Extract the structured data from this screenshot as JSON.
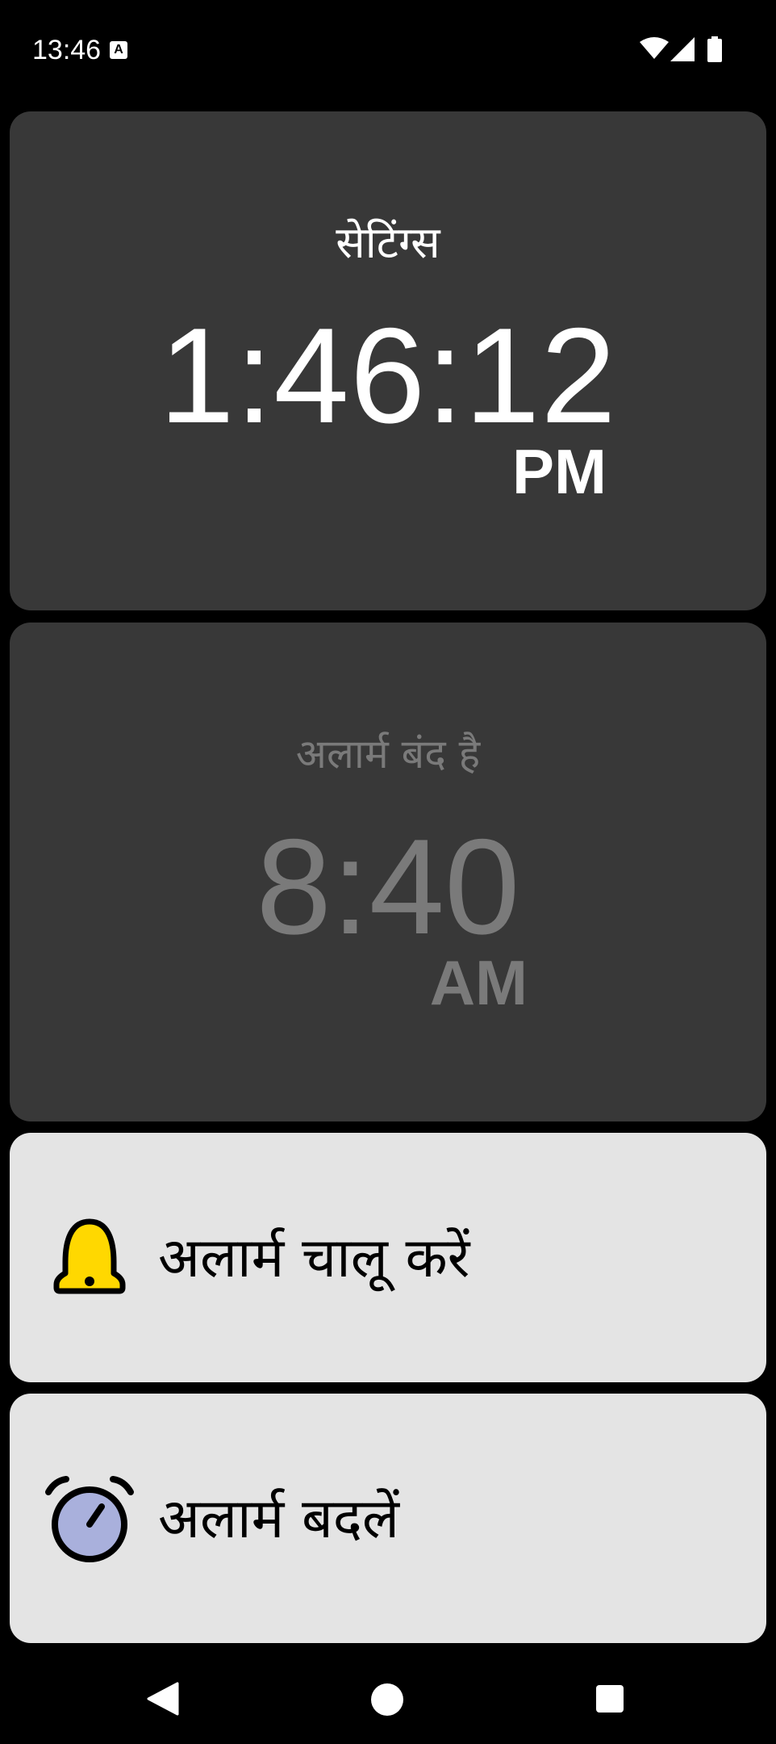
{
  "status_bar": {
    "time": "13:46",
    "notification_icon": "text-a-icon",
    "notification_label": "A",
    "icons": [
      "wifi-icon",
      "signal-icon",
      "battery-icon"
    ]
  },
  "clock": {
    "title": "सेटिंग्स",
    "time": "1:46:12",
    "ampm": "PM"
  },
  "alarm": {
    "status": "अलार्म बंद है",
    "time": "8:40",
    "ampm": "AM"
  },
  "actions": {
    "enable_alarm": {
      "label": "अलार्म चालू करें",
      "icon": "bell-icon"
    },
    "change_alarm": {
      "label": "अलार्म बदलें",
      "icon": "alarm-clock-icon"
    }
  },
  "nav_bar": {
    "icons": [
      "back-icon",
      "home-icon",
      "recents-icon"
    ]
  },
  "colors": {
    "card_dark": "#383838",
    "card_light": "#e4e4e4",
    "dimmed_text": "#7a7a7a",
    "bell_yellow": "#ffd800",
    "clock_face": "#a9b0dc"
  }
}
